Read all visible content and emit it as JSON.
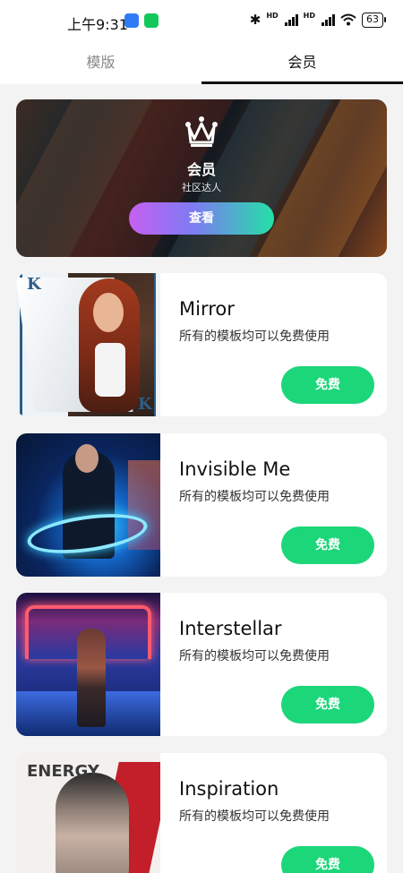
{
  "status_bar": {
    "time": "上午9:31",
    "battery": "63",
    "net_label_1": "HD",
    "net_label_2": "HD"
  },
  "tabs": [
    {
      "label": "模版",
      "active": false
    },
    {
      "label": "会员",
      "active": true
    }
  ],
  "banner": {
    "title": "会员",
    "subtitle": "社区达人",
    "button_label": "查看"
  },
  "cards": [
    {
      "title": "Mirror",
      "description": "所有的模板均可以免费使用",
      "button_label": "免费"
    },
    {
      "title": "Invisible Me",
      "description": "所有的模板均可以免费使用",
      "button_label": "免费"
    },
    {
      "title": "Interstellar",
      "description": "所有的模板均可以免费使用",
      "button_label": "免费"
    },
    {
      "title": "Inspiration",
      "description": "所有的模板均可以免费使用",
      "button_label": "免费"
    }
  ],
  "thumb_text": {
    "mirror_corner_top": "K",
    "mirror_corner_bottom": "K",
    "inspiration_letters": "ENERGY"
  },
  "colors": {
    "accent_green": "#1cd67a",
    "tab_underline": "#111111"
  }
}
